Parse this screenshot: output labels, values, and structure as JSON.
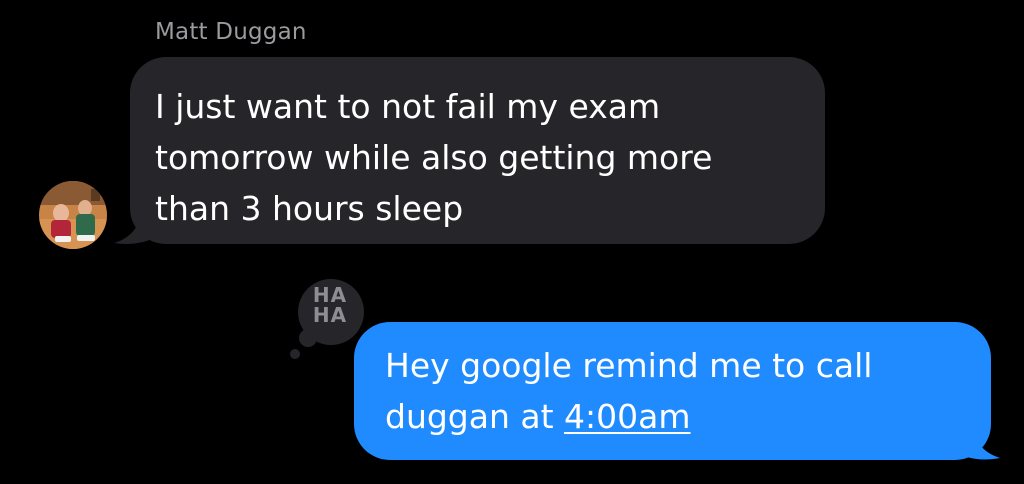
{
  "conversation": {
    "incoming": {
      "sender_name": "Matt Duggan",
      "lines": [
        "I just want to not fail my exam",
        "tomorrow while also getting more",
        "than 3 hours sleep"
      ],
      "avatar_icon": "contact-photo"
    },
    "reaction": {
      "label_line1": "HA",
      "label_line2": "HA",
      "icon": "haha-tapback-icon"
    },
    "outgoing": {
      "line1": "Hey google remind me to call",
      "line2_prefix": "duggan at ",
      "line2_link": "4:00am"
    }
  },
  "colors": {
    "background": "#000000",
    "incoming_bubble": "#26252a",
    "outgoing_bubble": "#1f8bff",
    "sender_name": "#9a9a9f",
    "reaction_bubble": "#26252a",
    "reaction_text": "#8d8d93"
  }
}
